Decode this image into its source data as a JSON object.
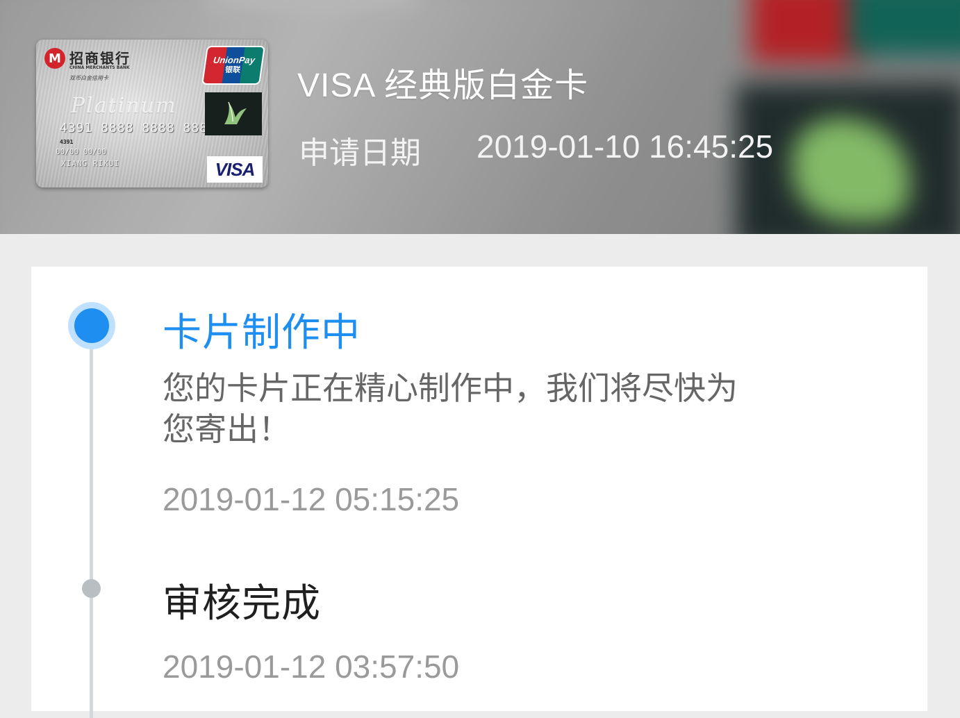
{
  "header": {
    "card_name": "VISA 经典版白金卡",
    "apply_label": "申请日期",
    "apply_datetime": "2019-01-10 16:45:25"
  },
  "card_image": {
    "bank_logo_letter": "M",
    "bank_name": "招商银行",
    "bank_name_en": "CHINA MERCHANTS BANK",
    "card_subtitle": "双币白金信用卡",
    "platinum_text": "Platinum",
    "card_number": "4391 8888 8888 8888",
    "number_prefix": "4391",
    "valid_text": "00/00   00/00",
    "holder_name": "XIANG RIKUI",
    "unionpay_en": "UnionPay",
    "unionpay_cn": "银联",
    "visa_text": "VISA",
    "colors": {
      "unionpay_red": "#d22630",
      "unionpay_blue": "#0f4e9a",
      "unionpay_green": "#0c7c6e",
      "visa_blue": "#1a1f71",
      "bank_red": "#d3242b"
    }
  },
  "progress": {
    "accent_color": "#1e8ff0",
    "steps": [
      {
        "title": "卡片制作中",
        "description": "您的卡片正在精心制作中，我们将尽快为您寄出！",
        "datetime": "2019-01-12 05:15:25",
        "status": "active"
      },
      {
        "title": "审核完成",
        "datetime": "2019-01-12 03:57:50",
        "status": "done"
      }
    ]
  }
}
